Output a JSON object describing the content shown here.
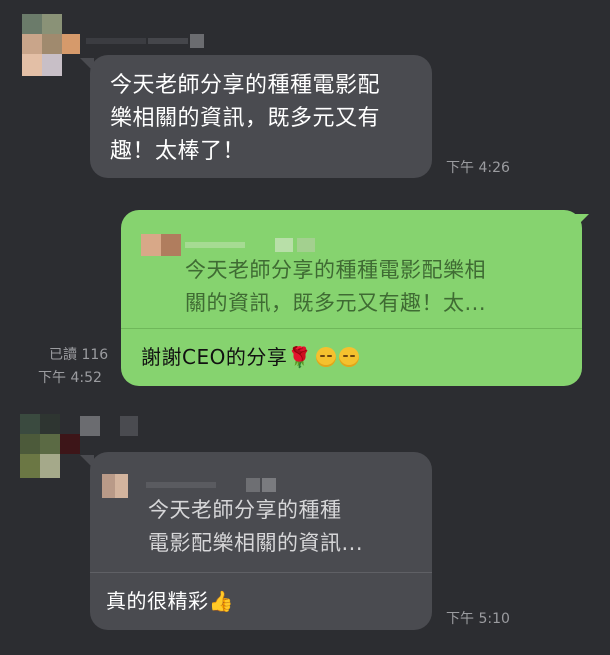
{
  "chat": {
    "messages": [
      {
        "direction": "incoming",
        "text_lines": [
          "今天老師分享的種種電影配",
          "樂相關的資訊，既多元又有",
          "趣！太棒了！"
        ],
        "time": "下午 4:26"
      },
      {
        "direction": "outgoing",
        "quote_lines": [
          "今天老師分享的種種電影配樂相",
          "關的資訊，既多元又有趣！太..."
        ],
        "text": "謝謝CEO的分享",
        "emoji": [
          "rose-icon",
          "winking-face-icon",
          "winking-face-icon"
        ],
        "read_receipt": "已讀 116",
        "time": "下午 4:52"
      },
      {
        "direction": "incoming",
        "quote_lines": [
          "今天老師分享的種種",
          "電影配樂相關的資訊..."
        ],
        "text": "真的很精彩",
        "emoji": [
          "thumbs-up-icon"
        ],
        "time": "下午 5:10"
      }
    ]
  },
  "colors": {
    "background": "#2c2d31",
    "incoming_bubble": "#4a4b50",
    "outgoing_bubble": "#86d36f",
    "timestamp": "#9b9ca0"
  }
}
